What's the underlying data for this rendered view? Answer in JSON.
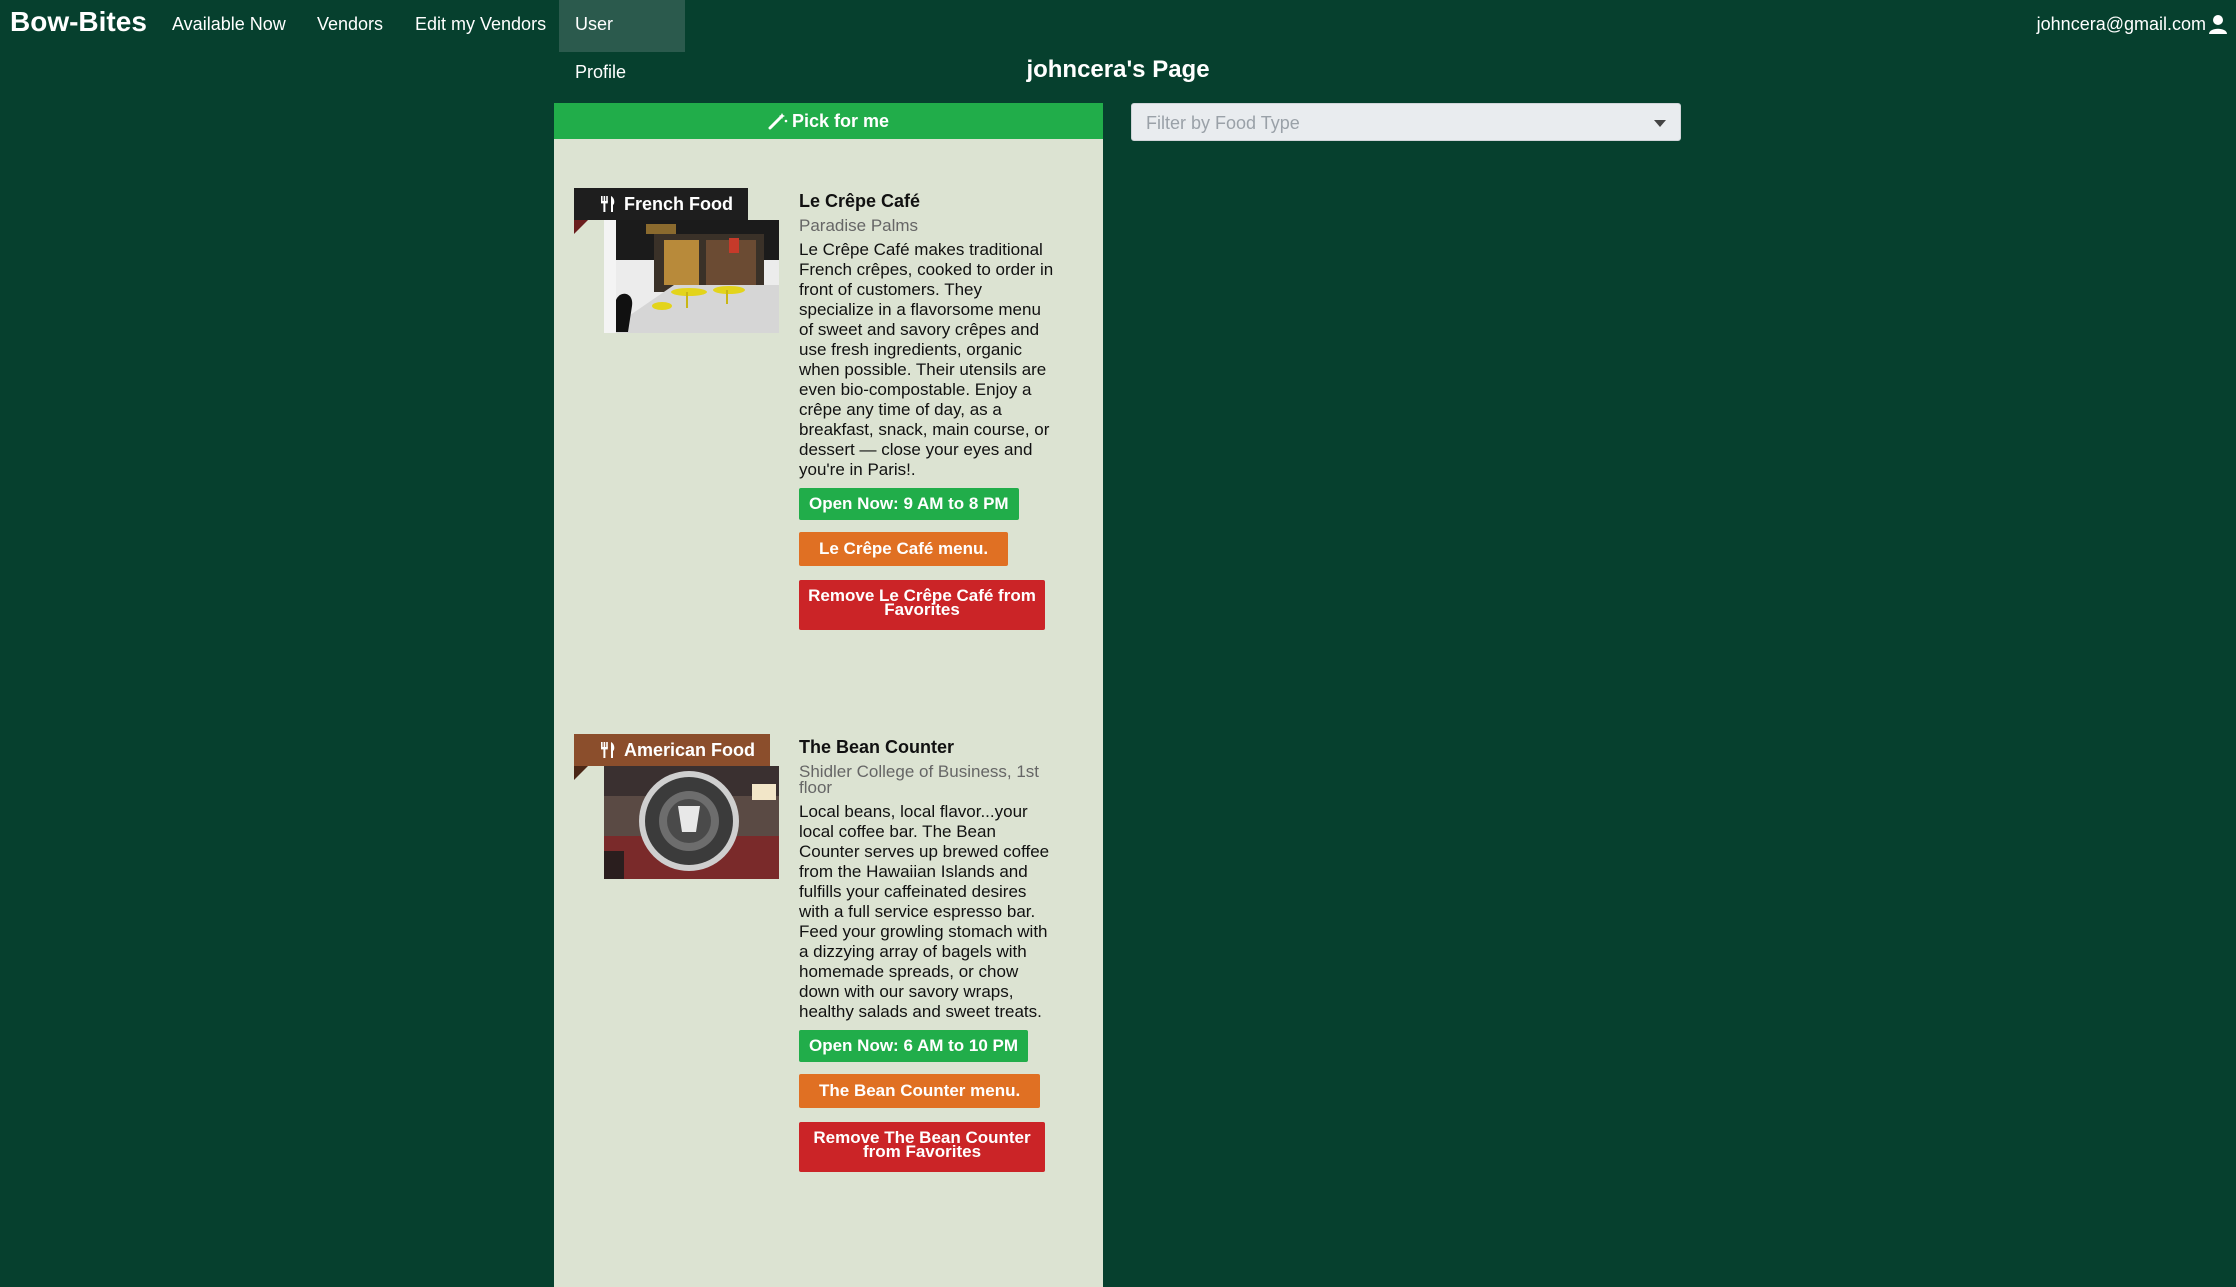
{
  "nav": {
    "brand": "Bow-Bites",
    "items": [
      {
        "label": "Available Now"
      },
      {
        "label": "Vendors"
      },
      {
        "label": "Edit my Vendors"
      },
      {
        "label": "User Profile"
      }
    ],
    "active_item": "User Profile",
    "user_email": "johncera@gmail.com",
    "user_icon": "user-icon"
  },
  "page": {
    "title": "johncera's Page",
    "pick_label": "Pick for me",
    "pick_icon": "magic-wand-icon",
    "filter_placeholder": "Filter by Food Type"
  },
  "colors": {
    "background": "#06402e",
    "panel": "#dce3d2",
    "green": "#21ad4a",
    "orange": "#e07023",
    "red": "#cb2427"
  },
  "vendors": [
    {
      "category": "French Food",
      "category_color": "#1e1e1e",
      "name": "Le Crêpe Café",
      "location": "Paradise Palms",
      "description": "Le Crêpe Café makes traditional French crêpes, cooked to order in front of customers. They specialize in a flavorsome menu of sweet and savory crêpes and use fresh ingredients, organic when possible. Their utensils are even bio-compostable. Enjoy a crêpe any time of day, as a breakfast, snack, main course, or dessert — close your eyes and you're in Paris!.",
      "hours": "Open Now: 9 AM to 8 PM",
      "menu_label": "Le Crêpe Café menu.",
      "remove_label": "Remove Le Crêpe Café from Favorites"
    },
    {
      "category": "American Food",
      "category_color": "#8b4e2c",
      "name": "The Bean Counter",
      "location": "Shidler College of Business, 1st floor",
      "description": "Local beans, local flavor...your local coffee bar. The Bean Counter serves up brewed coffee from the Hawaiian Islands and fulfills your caffeinated desires with a full service espresso bar. Feed your growling stomach with a dizzying array of bagels with homemade spreads, or chow down with our savory wraps, healthy salads and sweet treats.",
      "hours": "Open Now: 6 AM to 10 PM",
      "menu_label": "The Bean Counter menu.",
      "remove_label": "Remove The Bean Counter from Favorites"
    }
  ]
}
